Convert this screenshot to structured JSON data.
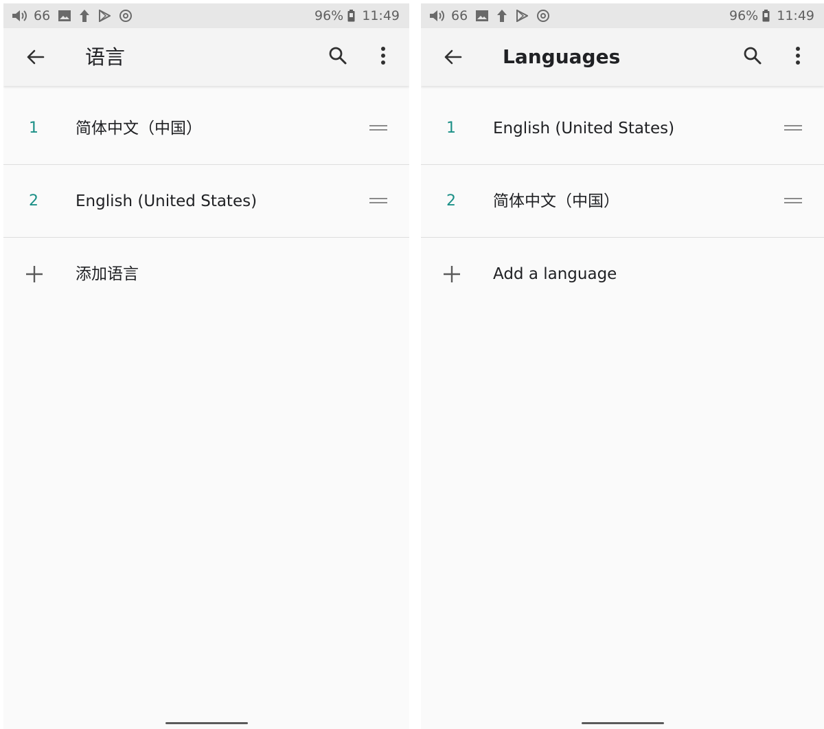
{
  "left": {
    "status": {
      "volume_level": "66",
      "battery_percent": "96%",
      "time": "11:49"
    },
    "title": "语言",
    "languages": [
      {
        "rank": "1",
        "name": "简体中文（中国）"
      },
      {
        "rank": "2",
        "name": "English (United States)"
      }
    ],
    "add_label": "添加语言"
  },
  "right": {
    "status": {
      "volume_level": "66",
      "battery_percent": "96%",
      "time": "11:49"
    },
    "title": "Languages",
    "languages": [
      {
        "rank": "1",
        "name": "English (United States)"
      },
      {
        "rank": "2",
        "name": "简体中文（中国）"
      }
    ],
    "add_label": "Add a language"
  },
  "icons": {
    "back": "arrow-back-icon",
    "search": "search-icon",
    "more": "more-vert-icon",
    "drag": "drag-handle-icon",
    "add": "plus-icon"
  },
  "colors": {
    "accent": "#1a8f86",
    "status_bar": "#e7e7e7",
    "background": "#fafafa"
  }
}
